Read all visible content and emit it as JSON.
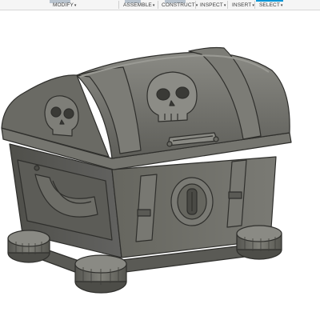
{
  "toolbar": {
    "menus": [
      {
        "label": "MODIFY",
        "caret": "▾"
      },
      {
        "label": "ASSEMBLE",
        "caret": "▾"
      },
      {
        "label": "CONSTRUCT",
        "caret": "▾"
      },
      {
        "label": "INSPECT",
        "caret": "▾"
      },
      {
        "label": "INSERT",
        "caret": "▾"
      },
      {
        "label": "SELECT",
        "caret": "▾"
      }
    ],
    "active_menu": "SELECT",
    "accent_color": "#0696d7"
  },
  "viewport": {
    "model_name": "treasure-chest-model",
    "background": "#ffffff",
    "model_color": "#6e6e68",
    "edge_color": "#2f2f2c"
  }
}
